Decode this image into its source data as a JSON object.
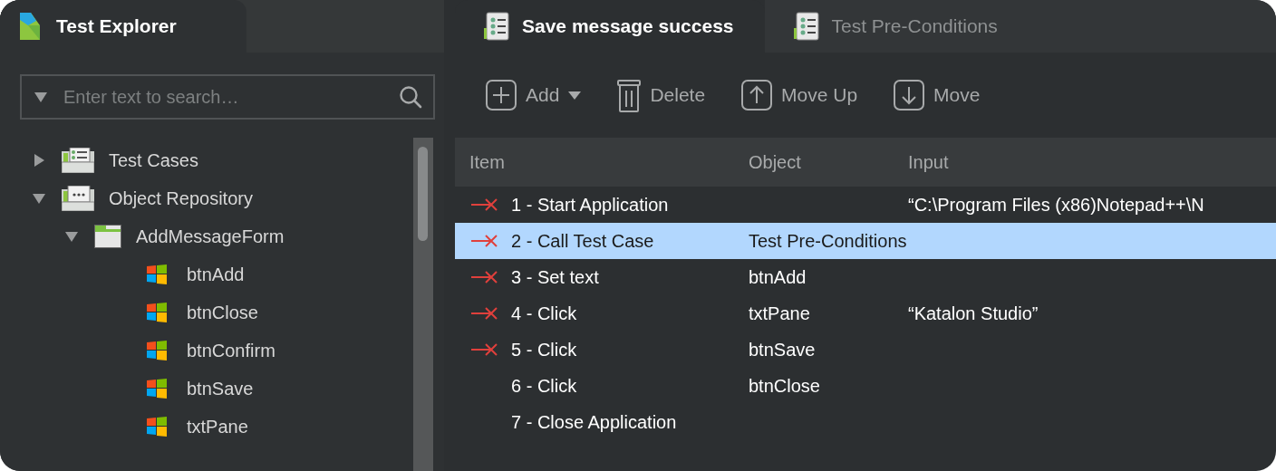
{
  "explorer": {
    "title": "Test Explorer",
    "search": {
      "placeholder": "Enter text to search…"
    },
    "tree": [
      {
        "label": "Test Cases",
        "kind": "cases",
        "expanded": false
      },
      {
        "label": "Object Repository",
        "kind": "repository",
        "expanded": true,
        "children": [
          {
            "label": "AddMessageForm",
            "kind": "folder",
            "expanded": true,
            "children": [
              {
                "label": "btnAdd",
                "kind": "object"
              },
              {
                "label": "btnClose",
                "kind": "object"
              },
              {
                "label": "btnConfirm",
                "kind": "object"
              },
              {
                "label": "btnSave",
                "kind": "object"
              },
              {
                "label": "txtPane",
                "kind": "object"
              }
            ]
          }
        ]
      }
    ]
  },
  "tabs": [
    {
      "label": "Save message success",
      "selected": true
    },
    {
      "label": "Test Pre-Conditions",
      "selected": false
    }
  ],
  "toolbar": [
    {
      "label": "Add",
      "kind": "add"
    },
    {
      "label": "Delete",
      "kind": "delete"
    },
    {
      "label": "Move Up",
      "kind": "up"
    },
    {
      "label": "Move",
      "kind": "down"
    }
  ],
  "table": {
    "columns": [
      "Item",
      "Object",
      "Input"
    ],
    "rows": [
      {
        "item": "1 - Start Application",
        "input": "“C:\\Program Files (x86)Notepad++\\N",
        "failed": true,
        "selected": false
      },
      {
        "item": "2 - Call Test Case",
        "object": "Test Pre-Conditions",
        "failed": true,
        "selected": true
      },
      {
        "item": "3 - Set text",
        "object": "btnAdd",
        "failed": true,
        "selected": false
      },
      {
        "item": "4 - Click",
        "object": "txtPane",
        "input": "“Katalon Studio”",
        "failed": true,
        "selected": false
      },
      {
        "item": "5 - Click",
        "object": "btnSave",
        "failed": true,
        "selected": false
      },
      {
        "item": "6 - Click",
        "object": "btnClose",
        "failed": false,
        "selected": false
      },
      {
        "item": "7 - Close Application",
        "failed": false,
        "selected": false
      }
    ]
  }
}
